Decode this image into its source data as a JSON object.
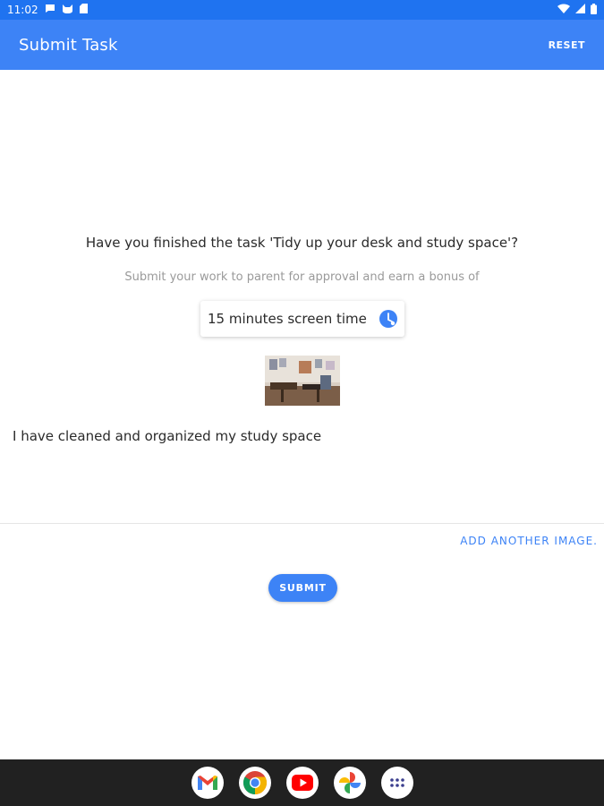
{
  "status_bar": {
    "time": "11:02",
    "icons": [
      "chat-bubble-icon",
      "cat-icon",
      "sd-card-icon",
      "wifi-icon",
      "signal-icon",
      "battery-icon"
    ]
  },
  "app_bar": {
    "title": "Submit Task",
    "reset_label": "RESET"
  },
  "task": {
    "question": "Have you finished the task 'Tidy up your desk and study space'?",
    "subtitle": "Submit your work to parent for approval and earn a bonus of",
    "reward": "15 minutes screen time",
    "reward_icon": "clock-icon",
    "comment": "I have cleaned and organized my study space",
    "add_image_label": "ADD ANOTHER IMAGE.",
    "submit_label": "SUBMIT"
  },
  "colors": {
    "primary": "#3d83f6",
    "status_bar": "#1f73f0",
    "nav_bar": "#212121"
  },
  "dock": {
    "apps": [
      "gmail-icon",
      "chrome-icon",
      "youtube-icon",
      "photos-icon",
      "app-drawer-icon"
    ]
  }
}
